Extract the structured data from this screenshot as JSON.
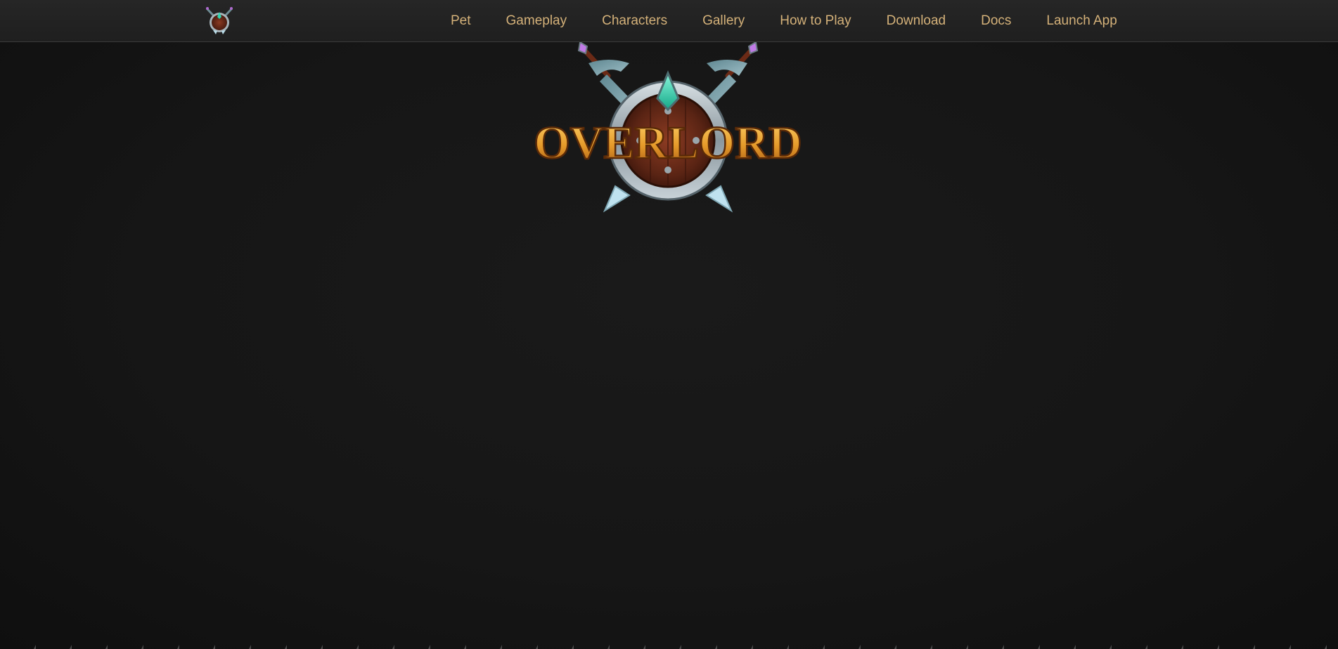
{
  "nav": {
    "logo_icon": "overlord-shield-icon",
    "links": [
      "Pet",
      "Gameplay",
      "Characters",
      "Gallery",
      "How to Play",
      "Download",
      "Docs",
      "Launch App"
    ]
  },
  "hero": {
    "logo_text": "OVERLORD"
  },
  "colors": {
    "nav_text": "#d4b179",
    "background": "#161616",
    "topbar": "#232323"
  }
}
